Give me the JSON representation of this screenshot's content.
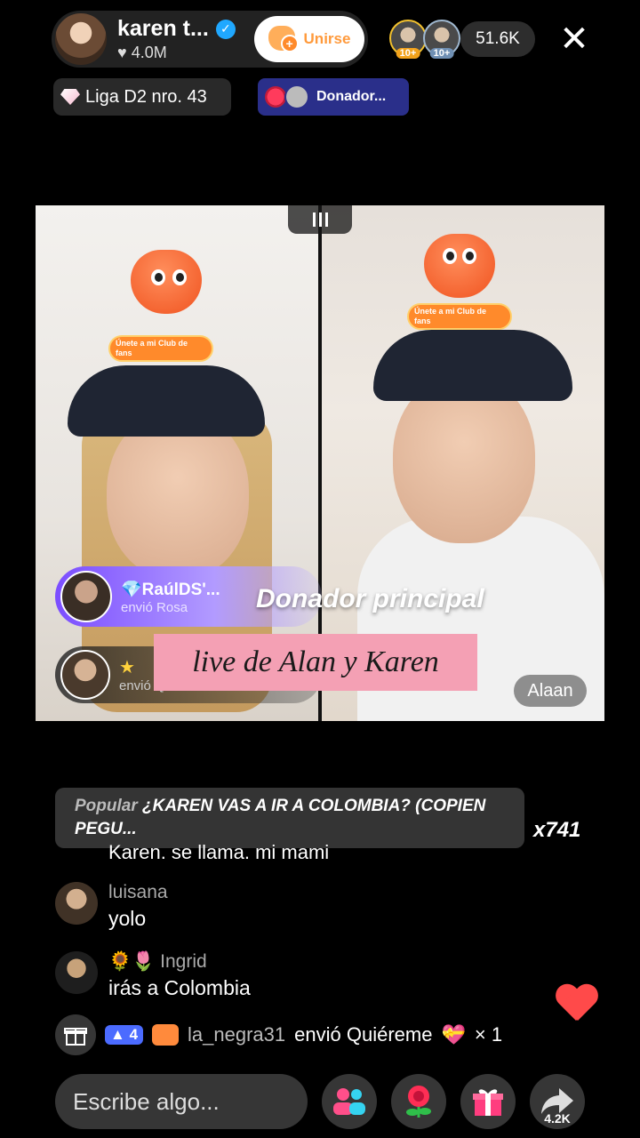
{
  "host": {
    "name": "karen t...",
    "likes": "4.0M",
    "join_label": "Unirse"
  },
  "viewers": {
    "levels": [
      "10+",
      "10+"
    ],
    "count": "51.6K"
  },
  "league": {
    "label": "Liga D2 nro. 43"
  },
  "donor_chip": {
    "label": "Donador..."
  },
  "fan_club": {
    "label": "Únete a mi Club de fans"
  },
  "gifts": [
    {
      "user": "RaúlDS'...",
      "action": "envió Rosa"
    },
    {
      "user": "",
      "action": "envió Quiéreme"
    }
  ],
  "overlay": {
    "donor_text": "Donador principal",
    "caption": "live de Alan y Karen",
    "name_tag": "Alaan"
  },
  "pinned": {
    "tag": "Popular",
    "text": "¿KAREN VAS A IR A COLOMBIA? (COPIEN PEGU..."
  },
  "combo": "x741",
  "comments": [
    {
      "user": "",
      "text": "Karen.  se llama.  mi mami"
    },
    {
      "user": "luisana",
      "text": "yolo"
    },
    {
      "user": "Ingrid",
      "text": "irás a Colombia"
    }
  ],
  "gift_bar": {
    "level": "4",
    "user": "la_negra31",
    "action": "envió Quiéreme",
    "count": "× 1"
  },
  "input": {
    "placeholder": "Escribe algo..."
  },
  "share": {
    "count": "4.2K"
  },
  "colors": {
    "accent_orange": "#ff9a3c",
    "verified_blue": "#20a8ff",
    "gift_purple": "#7b4dff",
    "caption_pink": "#f4a0b4",
    "heart_red": "#ff4a4a"
  }
}
